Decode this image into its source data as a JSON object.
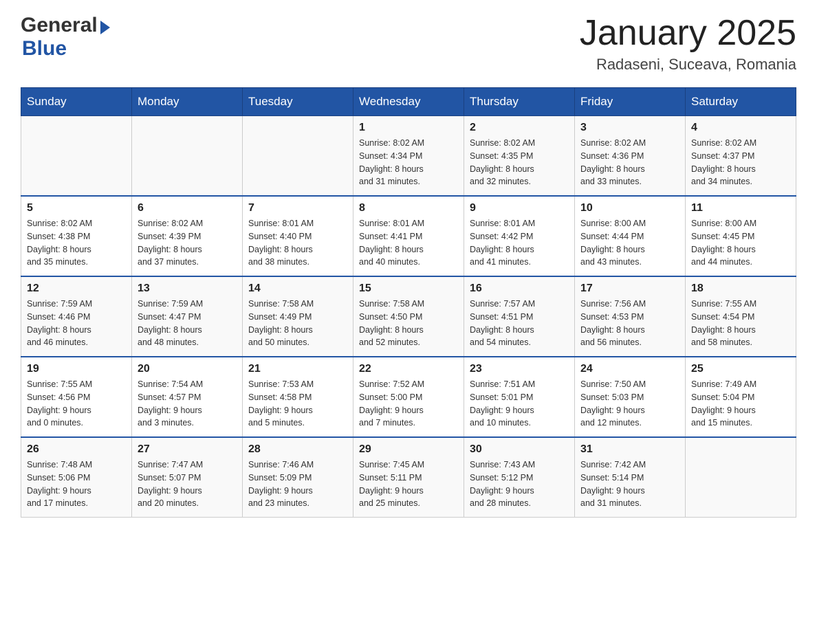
{
  "header": {
    "logo_general": "General",
    "logo_blue": "Blue",
    "title": "January 2025",
    "location": "Radaseni, Suceava, Romania"
  },
  "days_of_week": [
    "Sunday",
    "Monday",
    "Tuesday",
    "Wednesday",
    "Thursday",
    "Friday",
    "Saturday"
  ],
  "weeks": [
    [
      {
        "day": "",
        "info": ""
      },
      {
        "day": "",
        "info": ""
      },
      {
        "day": "",
        "info": ""
      },
      {
        "day": "1",
        "info": "Sunrise: 8:02 AM\nSunset: 4:34 PM\nDaylight: 8 hours\nand 31 minutes."
      },
      {
        "day": "2",
        "info": "Sunrise: 8:02 AM\nSunset: 4:35 PM\nDaylight: 8 hours\nand 32 minutes."
      },
      {
        "day": "3",
        "info": "Sunrise: 8:02 AM\nSunset: 4:36 PM\nDaylight: 8 hours\nand 33 minutes."
      },
      {
        "day": "4",
        "info": "Sunrise: 8:02 AM\nSunset: 4:37 PM\nDaylight: 8 hours\nand 34 minutes."
      }
    ],
    [
      {
        "day": "5",
        "info": "Sunrise: 8:02 AM\nSunset: 4:38 PM\nDaylight: 8 hours\nand 35 minutes."
      },
      {
        "day": "6",
        "info": "Sunrise: 8:02 AM\nSunset: 4:39 PM\nDaylight: 8 hours\nand 37 minutes."
      },
      {
        "day": "7",
        "info": "Sunrise: 8:01 AM\nSunset: 4:40 PM\nDaylight: 8 hours\nand 38 minutes."
      },
      {
        "day": "8",
        "info": "Sunrise: 8:01 AM\nSunset: 4:41 PM\nDaylight: 8 hours\nand 40 minutes."
      },
      {
        "day": "9",
        "info": "Sunrise: 8:01 AM\nSunset: 4:42 PM\nDaylight: 8 hours\nand 41 minutes."
      },
      {
        "day": "10",
        "info": "Sunrise: 8:00 AM\nSunset: 4:44 PM\nDaylight: 8 hours\nand 43 minutes."
      },
      {
        "day": "11",
        "info": "Sunrise: 8:00 AM\nSunset: 4:45 PM\nDaylight: 8 hours\nand 44 minutes."
      }
    ],
    [
      {
        "day": "12",
        "info": "Sunrise: 7:59 AM\nSunset: 4:46 PM\nDaylight: 8 hours\nand 46 minutes."
      },
      {
        "day": "13",
        "info": "Sunrise: 7:59 AM\nSunset: 4:47 PM\nDaylight: 8 hours\nand 48 minutes."
      },
      {
        "day": "14",
        "info": "Sunrise: 7:58 AM\nSunset: 4:49 PM\nDaylight: 8 hours\nand 50 minutes."
      },
      {
        "day": "15",
        "info": "Sunrise: 7:58 AM\nSunset: 4:50 PM\nDaylight: 8 hours\nand 52 minutes."
      },
      {
        "day": "16",
        "info": "Sunrise: 7:57 AM\nSunset: 4:51 PM\nDaylight: 8 hours\nand 54 minutes."
      },
      {
        "day": "17",
        "info": "Sunrise: 7:56 AM\nSunset: 4:53 PM\nDaylight: 8 hours\nand 56 minutes."
      },
      {
        "day": "18",
        "info": "Sunrise: 7:55 AM\nSunset: 4:54 PM\nDaylight: 8 hours\nand 58 minutes."
      }
    ],
    [
      {
        "day": "19",
        "info": "Sunrise: 7:55 AM\nSunset: 4:56 PM\nDaylight: 9 hours\nand 0 minutes."
      },
      {
        "day": "20",
        "info": "Sunrise: 7:54 AM\nSunset: 4:57 PM\nDaylight: 9 hours\nand 3 minutes."
      },
      {
        "day": "21",
        "info": "Sunrise: 7:53 AM\nSunset: 4:58 PM\nDaylight: 9 hours\nand 5 minutes."
      },
      {
        "day": "22",
        "info": "Sunrise: 7:52 AM\nSunset: 5:00 PM\nDaylight: 9 hours\nand 7 minutes."
      },
      {
        "day": "23",
        "info": "Sunrise: 7:51 AM\nSunset: 5:01 PM\nDaylight: 9 hours\nand 10 minutes."
      },
      {
        "day": "24",
        "info": "Sunrise: 7:50 AM\nSunset: 5:03 PM\nDaylight: 9 hours\nand 12 minutes."
      },
      {
        "day": "25",
        "info": "Sunrise: 7:49 AM\nSunset: 5:04 PM\nDaylight: 9 hours\nand 15 minutes."
      }
    ],
    [
      {
        "day": "26",
        "info": "Sunrise: 7:48 AM\nSunset: 5:06 PM\nDaylight: 9 hours\nand 17 minutes."
      },
      {
        "day": "27",
        "info": "Sunrise: 7:47 AM\nSunset: 5:07 PM\nDaylight: 9 hours\nand 20 minutes."
      },
      {
        "day": "28",
        "info": "Sunrise: 7:46 AM\nSunset: 5:09 PM\nDaylight: 9 hours\nand 23 minutes."
      },
      {
        "day": "29",
        "info": "Sunrise: 7:45 AM\nSunset: 5:11 PM\nDaylight: 9 hours\nand 25 minutes."
      },
      {
        "day": "30",
        "info": "Sunrise: 7:43 AM\nSunset: 5:12 PM\nDaylight: 9 hours\nand 28 minutes."
      },
      {
        "day": "31",
        "info": "Sunrise: 7:42 AM\nSunset: 5:14 PM\nDaylight: 9 hours\nand 31 minutes."
      },
      {
        "day": "",
        "info": ""
      }
    ]
  ]
}
